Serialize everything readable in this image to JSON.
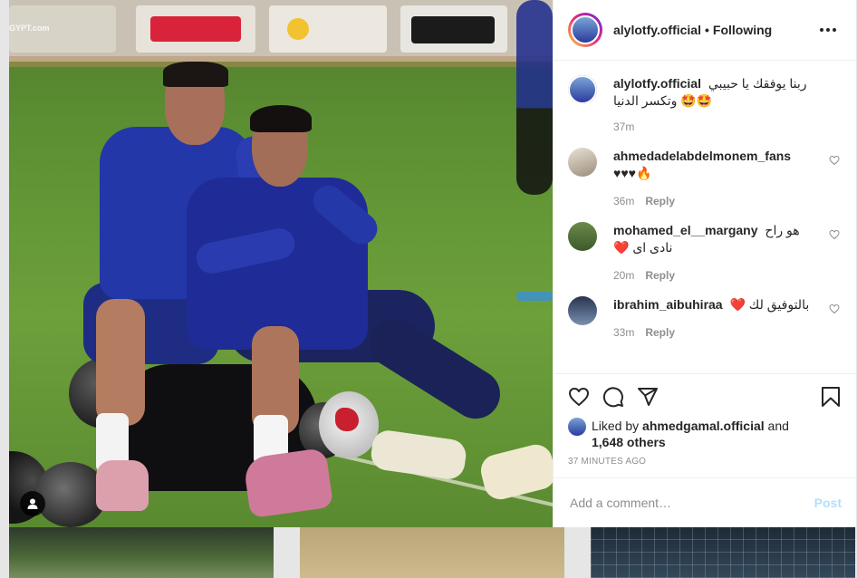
{
  "header": {
    "username": "alylotfy.official",
    "separator": "•",
    "follow_status": "Following"
  },
  "photo": {
    "watermark": "GYPT.com"
  },
  "caption": {
    "username": "alylotfy.official",
    "text": "ربنا يوفقك يا حبيبي 🤩🤩 وتكسر الدنيا",
    "time": "37m"
  },
  "comments": [
    {
      "username": "ahmedadelabdelmonem_fans",
      "text": "♥♥♥🔥",
      "time": "36m",
      "reply": "Reply"
    },
    {
      "username": "mohamed_el__margany",
      "text": "هو راح نادى اى ❤️",
      "time": "20m",
      "reply": "Reply"
    },
    {
      "username": "ibrahim_aibuhiraa",
      "text": "بالتوفيق لك ❤️",
      "time": "33m",
      "reply": "Reply"
    }
  ],
  "likes": {
    "prefix": "Liked by",
    "user": "ahmedgamal.official",
    "conj": "and",
    "others": "1,648 others"
  },
  "timestamp": "37 MINUTES AGO",
  "add_comment": {
    "placeholder": "Add a comment…",
    "post_label": "Post"
  },
  "colors": {
    "accent": "#0095f6",
    "post_disabled": "#b2dffc",
    "text": "#262626",
    "muted": "#8e8e8e"
  },
  "icons": [
    "heart-icon",
    "comment-icon",
    "share-icon",
    "bookmark-icon",
    "more-icon",
    "user-tag-icon"
  ]
}
